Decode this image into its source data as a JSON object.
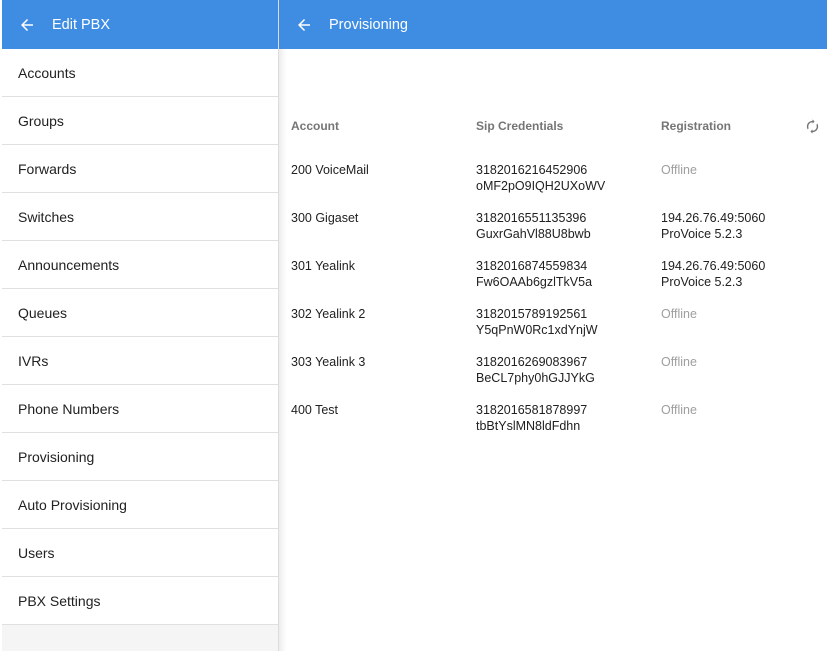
{
  "sidebar": {
    "title": "Edit PBX",
    "items": [
      {
        "label": "Accounts"
      },
      {
        "label": "Groups"
      },
      {
        "label": "Forwards"
      },
      {
        "label": "Switches"
      },
      {
        "label": "Announcements"
      },
      {
        "label": "Queues"
      },
      {
        "label": "IVRs"
      },
      {
        "label": "Phone Numbers"
      },
      {
        "label": "Provisioning"
      },
      {
        "label": "Auto Provisioning"
      },
      {
        "label": "Users"
      },
      {
        "label": "PBX Settings"
      }
    ]
  },
  "main": {
    "title": "Provisioning",
    "columns": {
      "account": "Account",
      "sip": "Sip Credentials",
      "registration": "Registration"
    },
    "rows": [
      {
        "account": "200 VoiceMail",
        "sip_user": "3182016216452906",
        "sip_pass": "oMF2pO9IQH2UXoWV",
        "reg_line1": "Offline",
        "reg_line2": "",
        "status": "offline"
      },
      {
        "account": "300 Gigaset",
        "sip_user": "3182016551135396",
        "sip_pass": "GuxrGahVl88U8bwb",
        "reg_line1": "194.26.76.49:5060",
        "reg_line2": "ProVoice 5.2.3",
        "status": "online"
      },
      {
        "account": "301 Yealink",
        "sip_user": "3182016874559834",
        "sip_pass": "Fw6OAAb6gzlTkV5a",
        "reg_line1": "194.26.76.49:5060",
        "reg_line2": "ProVoice 5.2.3",
        "status": "online"
      },
      {
        "account": "302 Yealink 2",
        "sip_user": "3182015789192561",
        "sip_pass": "Y5qPnW0Rc1xdYnjW",
        "reg_line1": "Offline",
        "reg_line2": "",
        "status": "offline"
      },
      {
        "account": "303 Yealink 3",
        "sip_user": "3182016269083967",
        "sip_pass": "BeCL7phy0hGJJYkG",
        "reg_line1": "Offline",
        "reg_line2": "",
        "status": "offline"
      },
      {
        "account": "400 Test",
        "sip_user": "3182016581878997",
        "sip_pass": "tbBtYslMN8ldFdhn",
        "reg_line1": "Offline",
        "reg_line2": "",
        "status": "offline"
      }
    ]
  },
  "icons": {
    "back": "arrow-left-icon",
    "refresh": "refresh-icon"
  },
  "colors": {
    "header_bg": "#3f8de3",
    "offline_text": "#9e9e9e"
  }
}
